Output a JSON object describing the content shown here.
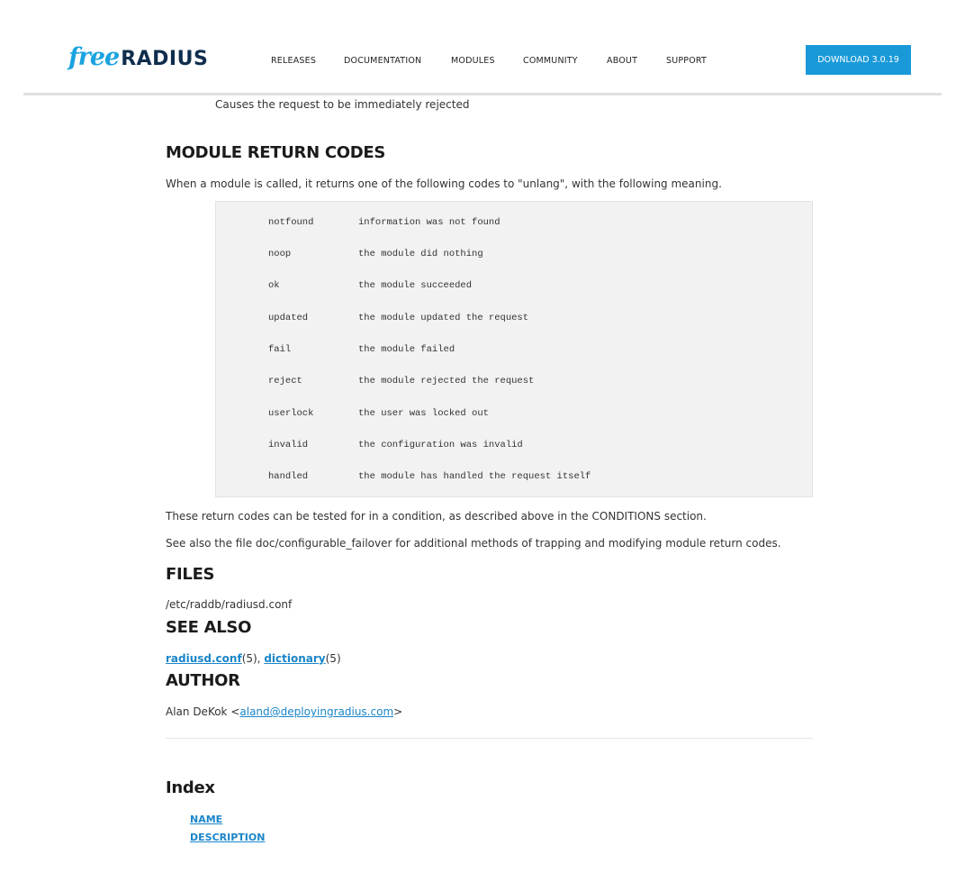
{
  "header": {
    "logo_free": "free",
    "logo_radius": "RADIUS",
    "nav": [
      "RELEASES",
      "DOCUMENTATION",
      "MODULES",
      "COMMUNITY",
      "ABOUT",
      "SUPPORT"
    ],
    "download_label": "DOWNLOAD 3.0.19"
  },
  "content": {
    "reject_desc": "Causes the request to be immediately rejected",
    "return_codes": {
      "heading": "MODULE RETURN CODES",
      "intro": "When a module is called, it returns one of the following codes to \"unlang\", with the following meaning.",
      "codes": [
        {
          "key": "notfound",
          "desc": "information was not found"
        },
        {
          "key": "noop",
          "desc": "the module did nothing"
        },
        {
          "key": "ok",
          "desc": "the module succeeded"
        },
        {
          "key": "updated",
          "desc": "the module updated the request"
        },
        {
          "key": "fail",
          "desc": "the module failed"
        },
        {
          "key": "reject",
          "desc": "the module rejected the request"
        },
        {
          "key": "userlock",
          "desc": "the user was locked out"
        },
        {
          "key": "invalid",
          "desc": "the configuration was invalid"
        },
        {
          "key": "handled",
          "desc": "the module has handled the request itself"
        }
      ],
      "after1": "These return codes can be tested for in a condition, as described above in the CONDITIONS section.",
      "after2": "See also the file doc/configurable_failover for additional methods of trapping and modifying module return codes."
    },
    "files": {
      "heading": "FILES",
      "path": "/etc/raddb/radiusd.conf"
    },
    "see_also": {
      "heading": "SEE ALSO",
      "link1": "radiusd.conf",
      "suffix1": "(5), ",
      "link2": "dictionary",
      "suffix2": "(5)"
    },
    "author": {
      "heading": "AUTHOR",
      "prefix": "Alan DeKok <",
      "email": "aland@deployingradius.com",
      "suffix": ">"
    },
    "index": {
      "heading": "Index",
      "links": [
        "NAME",
        "DESCRIPTION"
      ]
    }
  }
}
